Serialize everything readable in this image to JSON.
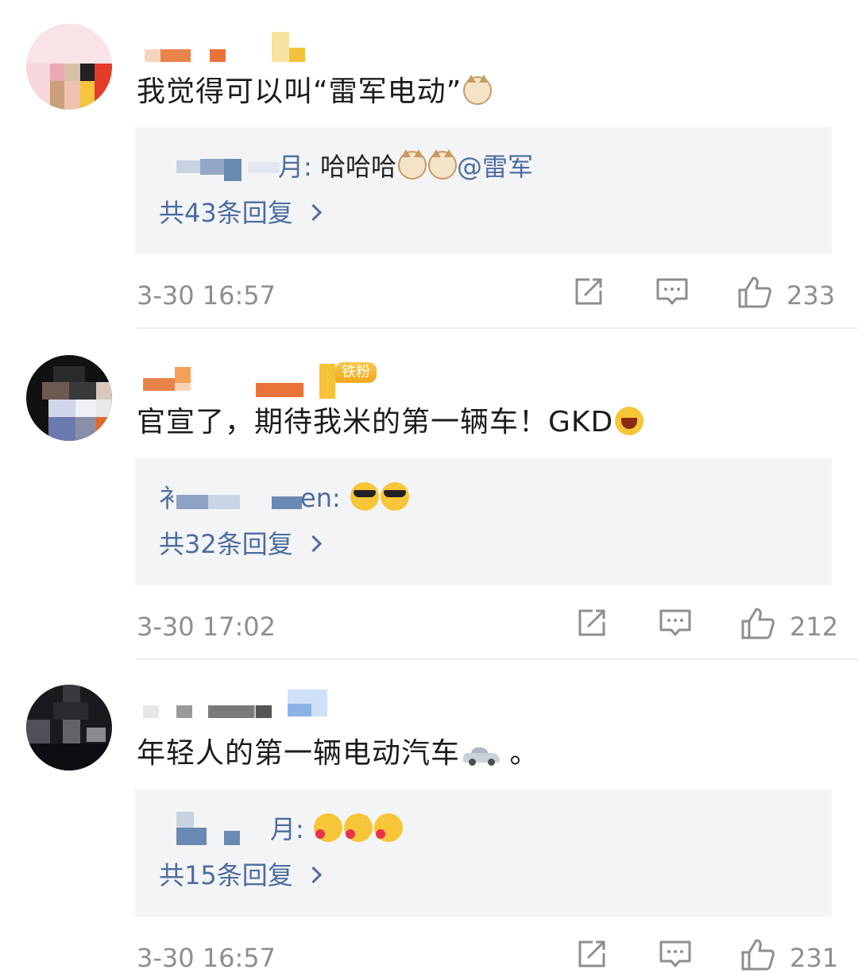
{
  "comments": [
    {
      "text": "我觉得可以叫“雷军电动”",
      "text_emoji": "cat-face-emoji",
      "badge": "",
      "reply_preview": {
        "name_visible": "月:",
        "text": "哈哈哈",
        "emojis": [
          "cat-face-emoji",
          "cat-face-emoji"
        ],
        "mention": "@雷军"
      },
      "reply_count": "共43条回复",
      "time": "3-30 16:57",
      "likes": "233"
    },
    {
      "text": "官宣了，期待我米的第一辆车！GKD",
      "text_emoji": "laughing-emoji",
      "badge": "铁粉",
      "reply_preview": {
        "name_visible": "en:",
        "name_prefix": "衤",
        "text": "",
        "emojis": [
          "sunglasses-emoji",
          "sunglasses-emoji"
        ],
        "mention": ""
      },
      "reply_count": "共32条回复",
      "time": "3-30 17:02",
      "likes": "212"
    },
    {
      "text": "年轻人的第一辆电动汽车",
      "text_suffix": " 。",
      "text_emoji": "car-emoji",
      "badge": "",
      "reply_preview": {
        "name_visible": "月:",
        "text": "",
        "emojis": [
          "blowing-kiss-emoji",
          "blowing-kiss-emoji",
          "blowing-kiss-emoji"
        ],
        "mention": ""
      },
      "reply_count": "共15条回复",
      "time": "3-30 16:57",
      "likes": "231"
    }
  ],
  "icons": {
    "repost": "repost-icon",
    "comment": "comment-icon",
    "like": "thumbs-up-icon"
  },
  "colors": {
    "link": "#4c6c9e",
    "meta": "#8e8e8e",
    "reply_bg": "#f3f4f6",
    "badge": "#f0a81e"
  }
}
